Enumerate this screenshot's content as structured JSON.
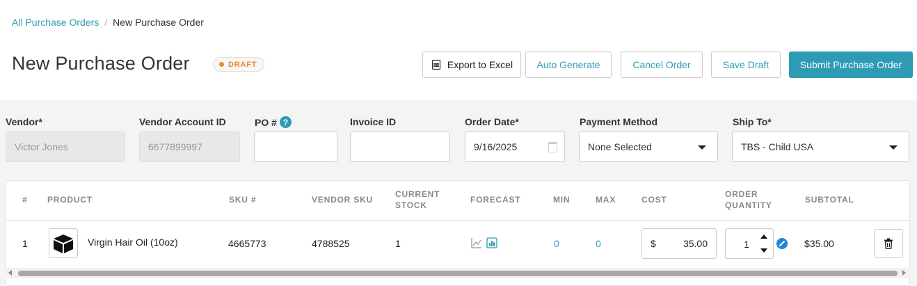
{
  "breadcrumb": {
    "parent": "All Purchase Orders",
    "separator": "/",
    "current": "New Purchase Order"
  },
  "header": {
    "title": "New Purchase Order",
    "status_badge": "DRAFT",
    "status_color": "#f0872a"
  },
  "actions": {
    "export": "Export to Excel",
    "auto_generate": "Auto Generate",
    "cancel": "Cancel Order",
    "save_draft": "Save Draft",
    "submit": "Submit Purchase Order"
  },
  "form": {
    "vendor": {
      "label": "Vendor*",
      "value": "Victor Jones"
    },
    "vendor_account": {
      "label": "Vendor Account ID",
      "value": "6677899997"
    },
    "po_number": {
      "label": "PO #",
      "value": "",
      "help_icon": "?"
    },
    "invoice_id": {
      "label": "Invoice ID",
      "value": ""
    },
    "order_date": {
      "label": "Order Date*",
      "value": "9/16/2025"
    },
    "payment_method": {
      "label": "Payment Method",
      "value": "None Selected"
    },
    "ship_to": {
      "label": "Ship To*",
      "value": "TBS - Child USA"
    }
  },
  "table": {
    "columns": {
      "num": "#",
      "product": "PRODUCT",
      "sku": "SKU #",
      "vendor_sku": "VENDOR SKU",
      "current_stock_1": "CURRENT",
      "current_stock_2": "STOCK",
      "forecast": "FORECAST",
      "min": "MIN",
      "max": "MAX",
      "cost": "COST",
      "order_qty_1": "ORDER",
      "order_qty_2": "QUANTITY",
      "subtotal": "SUBTOTAL"
    },
    "rows": [
      {
        "num": "1",
        "product": "Virgin Hair Oil (10oz)",
        "sku": "4665773",
        "vendor_sku": "4788525",
        "current_stock": "1",
        "min": "0",
        "max": "0",
        "cost_symbol": "$",
        "cost": "35.00",
        "order_quantity": "1",
        "subtotal": "$35.00"
      }
    ]
  },
  "icons": {
    "export": "excel-file-icon",
    "forecast_line": "line-chart-icon",
    "forecast_bar": "bar-chart-icon",
    "edit": "pencil-icon",
    "delete": "trash-icon",
    "product": "box-icon",
    "calendar": "calendar-icon"
  },
  "theme": {
    "accent": "#2e9bb5",
    "edit_blue": "#1e88d8"
  }
}
